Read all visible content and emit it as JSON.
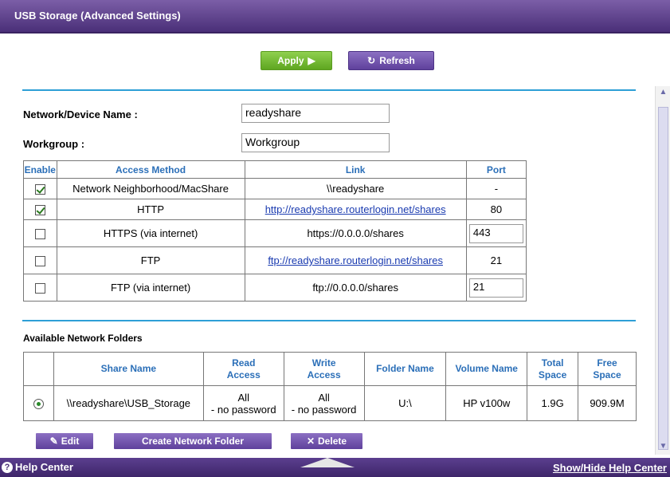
{
  "window": {
    "title": "USB Storage (Advanced Settings)"
  },
  "toolbar": {
    "apply_label": "Apply",
    "refresh_label": "Refresh"
  },
  "form": {
    "device_name_label": "Network/Device Name :",
    "device_name_value": "readyshare",
    "workgroup_label": "Workgroup :",
    "workgroup_value": "Workgroup"
  },
  "access_table": {
    "headers": [
      "Enable",
      "Access Method",
      "Link",
      "Port"
    ],
    "rows": [
      {
        "enabled": true,
        "method": "Network Neighborhood/MacShare",
        "link": "\\\\readyshare",
        "link_is_url": false,
        "port": "-",
        "port_editable": false
      },
      {
        "enabled": true,
        "method": "HTTP",
        "link": "http://readyshare.routerlogin.net/shares",
        "link_is_url": true,
        "port": "80",
        "port_editable": false
      },
      {
        "enabled": false,
        "method": "HTTPS (via internet)",
        "link": "https://0.0.0.0/shares",
        "link_is_url": false,
        "port": "443",
        "port_editable": true
      },
      {
        "enabled": false,
        "method": "FTP",
        "link": "ftp://readyshare.routerlogin.net/shares",
        "link_is_url": true,
        "port": "21",
        "port_editable": false
      },
      {
        "enabled": false,
        "method": "FTP (via internet)",
        "link": "ftp://0.0.0.0/shares",
        "link_is_url": false,
        "port": "21",
        "port_editable": true
      }
    ]
  },
  "folders": {
    "section_title": "Available Network Folders",
    "headers": {
      "share_name": "Share Name",
      "read_access_1": "Read",
      "read_access_2": "Access",
      "write_access_1": "Write",
      "write_access_2": "Access",
      "folder_name": "Folder Name",
      "volume_name": "Volume Name",
      "total_space_1": "Total",
      "total_space_2": "Space",
      "free_space_1": "Free",
      "free_space_2": "Space"
    },
    "rows": [
      {
        "selected": true,
        "share_name": "\\\\readyshare\\USB_Storage",
        "read_access_1": "All",
        "read_access_2": "- no password",
        "write_access_1": "All",
        "write_access_2": "- no password",
        "folder_name": "U:\\",
        "volume_name": "HP v100w",
        "total_space": "1.9G",
        "free_space": "909.9M"
      }
    ]
  },
  "actions": {
    "edit_label": "Edit",
    "create_label": "Create Network Folder",
    "delete_label": "Delete"
  },
  "footer": {
    "help_label": "Help Center",
    "toggle_label": "Show/Hide Help Center"
  },
  "colors": {
    "titlebar": "#4a2f78",
    "apply": "#6fb82f",
    "refresh": "#6a4fa8",
    "header_text": "#2b6fb8",
    "rule": "#2e9fd6"
  }
}
